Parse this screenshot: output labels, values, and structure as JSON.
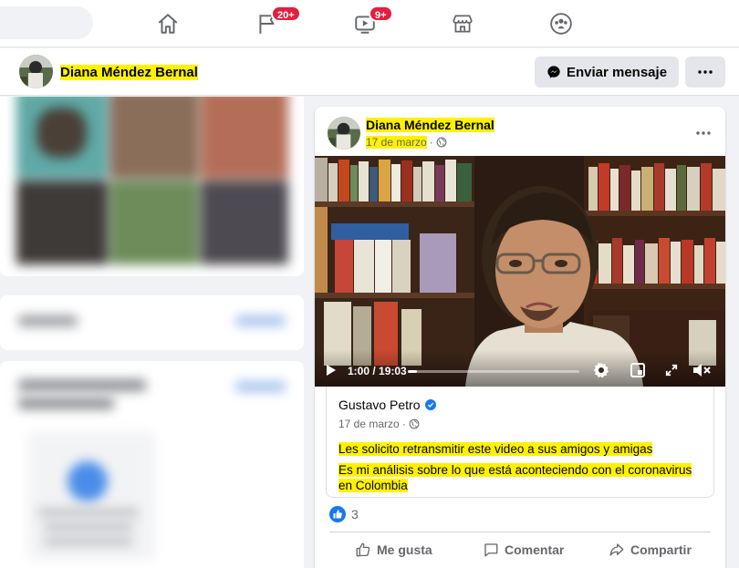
{
  "nav": {
    "items": [
      {
        "icon": "home-icon",
        "badge": ""
      },
      {
        "icon": "pages-flag-icon",
        "badge": "20+"
      },
      {
        "icon": "watch-video-icon",
        "badge": "9+"
      },
      {
        "icon": "marketplace-icon",
        "badge": ""
      },
      {
        "icon": "groups-icon",
        "badge": ""
      }
    ]
  },
  "profile": {
    "name": "Diana Méndez Bernal",
    "message_button": "Enviar mensaje",
    "more_button": "more-horizontal-icon"
  },
  "post": {
    "author": "Diana Méndez Bernal",
    "date": "17 de marzo",
    "privacy_icon": "globe-icon",
    "video": {
      "time": "1:00 / 19:03",
      "progress": 0.052
    },
    "shared": {
      "author": "Gustavo Petro",
      "verified_icon": "verified-badge-icon",
      "date": "17 de marzo",
      "line1": "Les solicito retransmitir este video a sus amigos y amigas",
      "line2a": "Es mi análisis sobre lo que está aconteciendo con el coronavirus",
      "line2b": "en Colombia"
    },
    "reaction_count": "3",
    "actions": {
      "like": "Me gusta",
      "comment": "Comentar",
      "share": "Compartir"
    }
  },
  "colors": {
    "highlight": "#fff200",
    "brand_blue": "#1877f2",
    "badge_red": "#e41e3f"
  }
}
